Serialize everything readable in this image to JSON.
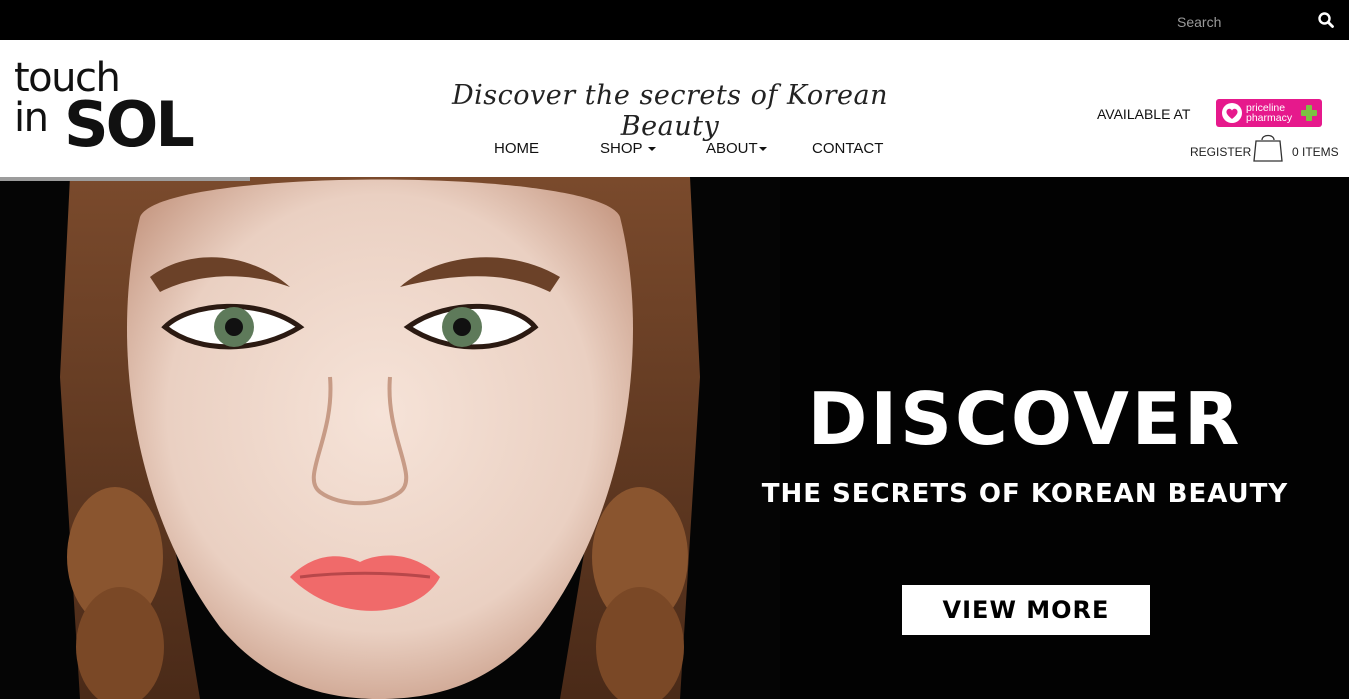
{
  "topbar": {
    "search": {
      "placeholder": "Search"
    }
  },
  "header": {
    "logo": {
      "line1": "touch",
      "line2": "in",
      "line3": "SOL"
    },
    "tagline": "Discover the secrets of Korean Beauty",
    "nav": [
      {
        "label": "HOME",
        "dropdown": false
      },
      {
        "label": "SHOP",
        "dropdown": true
      },
      {
        "label": "ABOUT",
        "dropdown": true
      },
      {
        "label": "CONTACT",
        "dropdown": false
      }
    ],
    "available_at": "AVAILABLE AT",
    "priceline": {
      "line1": "priceline",
      "line2": "pharmacy"
    },
    "register": "REGISTER",
    "cart_items": "0 ITEMS"
  },
  "hero": {
    "title": "DISCOVER",
    "subtitle": "THE SECRETS OF KOREAN BEAUTY",
    "button": "VIEW MORE",
    "slide_progress": 0.185
  },
  "colors": {
    "topbar": "#000000",
    "priceline_brand": "#e6198c",
    "priceline_cross": "#7cc242",
    "hero_bg": "#020202"
  },
  "icons": [
    "search-icon",
    "shopping-bag-icon",
    "priceline-heart-icon",
    "pharmacy-cross-icon",
    "caret-down-icon"
  ]
}
